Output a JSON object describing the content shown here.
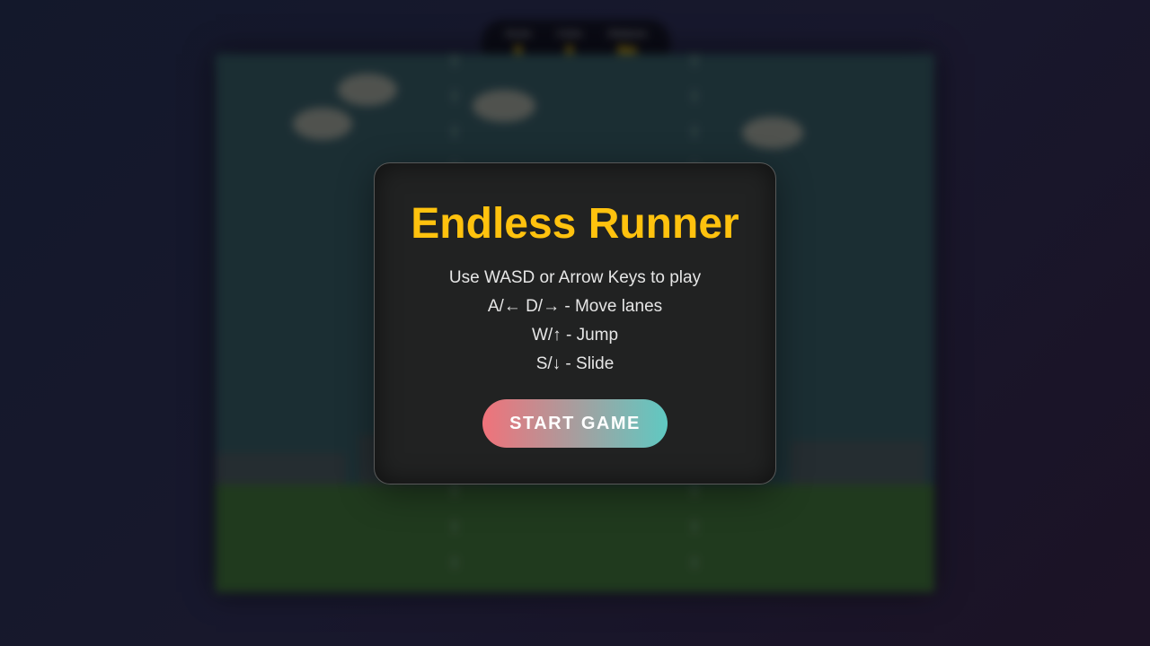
{
  "hud": {
    "score_label": "Score",
    "score_value": "0",
    "coins_label": "Coins",
    "coins_value": "0",
    "distance_label": "Distance",
    "distance_value": "0m"
  },
  "menu": {
    "title": "Endless Runner",
    "instructions": [
      "Use WASD or Arrow Keys to play",
      "A/← D/→ - Move lanes",
      "W/↑ - Jump",
      "S/↓ - Slide"
    ],
    "start_label": "START GAME"
  },
  "colors": {
    "title": "#ffc20e",
    "hud_value": "#ffcc00",
    "button_gradient_start": "#f0727a",
    "button_gradient_end": "#5fc9c2",
    "ground": "#24421f",
    "sky": "#1e3438"
  }
}
